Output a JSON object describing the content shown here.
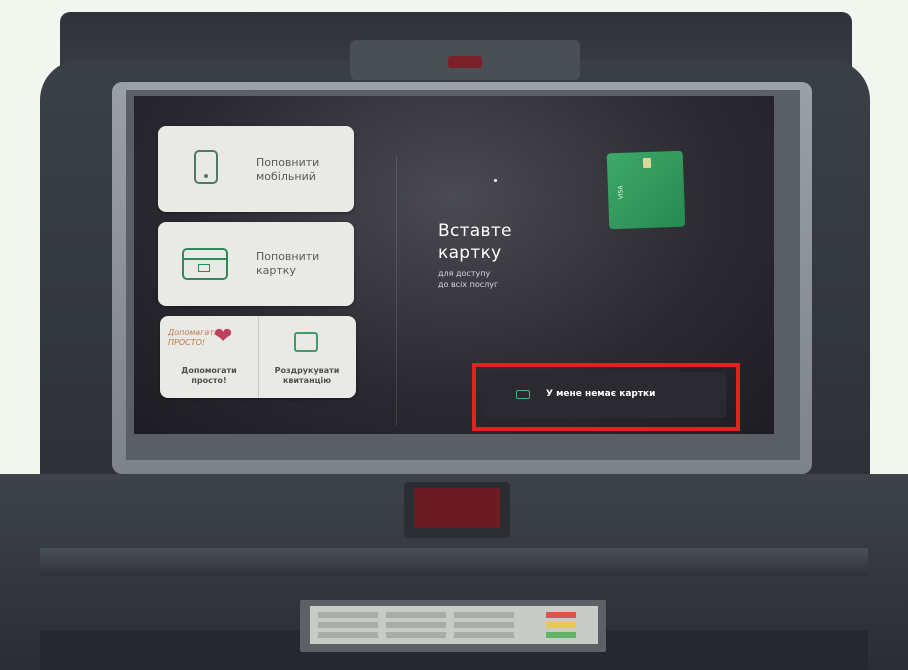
{
  "menu": {
    "top_up_mobile": {
      "label_line1": "Поповнити",
      "label_line2": "мобільний"
    },
    "top_up_card": {
      "label_line1": "Поповнити",
      "label_line2": "картку"
    },
    "help_easy": {
      "logo_line1": "Допомагать",
      "logo_line2": "ПРОСТО!",
      "label_line1": "Допомогати",
      "label_line2": "просто!"
    },
    "print_receipt": {
      "label_line1": "Роздрукувати",
      "label_line2": "квитанцію"
    }
  },
  "insert_card": {
    "title_line1": "Вставте",
    "title_line2": "картку",
    "subtitle_line1": "для доступу",
    "subtitle_line2": "до всіх послуг"
  },
  "no_card_button": {
    "label": "У мене немає картки"
  },
  "card_image": {
    "brand": "VISA"
  },
  "colors": {
    "accent_green": "#2f8a5a",
    "highlight_red": "#e0231e",
    "screen_bg": "#2a2930"
  },
  "icons": [
    "phone-icon",
    "card-icon",
    "heart-icon",
    "receipt-icon"
  ]
}
